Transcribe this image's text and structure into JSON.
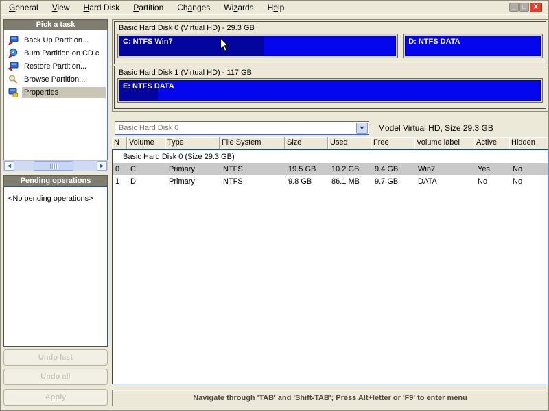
{
  "menu": {
    "items": [
      {
        "pre": "",
        "key": "G",
        "post": "eneral"
      },
      {
        "pre": "",
        "key": "V",
        "post": "iew"
      },
      {
        "pre": "",
        "key": "H",
        "post": "ard Disk"
      },
      {
        "pre": "",
        "key": "P",
        "post": "artition"
      },
      {
        "pre": "Ch",
        "key": "a",
        "post": "nges"
      },
      {
        "pre": "Wi",
        "key": "z",
        "post": "ards"
      },
      {
        "pre": "H",
        "key": "e",
        "post": "lp"
      }
    ]
  },
  "window_controls": {
    "minimize": "_",
    "maximize": "□",
    "close": "✕"
  },
  "sidebar": {
    "pick_task_title": "Pick a task",
    "tasks": [
      {
        "icon": "backup-disk-icon",
        "label": "Back Up Partition..."
      },
      {
        "icon": "burn-cd-icon",
        "label": "Burn Partition on CD c"
      },
      {
        "icon": "restore-disk-icon",
        "label": "Restore Partition..."
      },
      {
        "icon": "browse-icon",
        "label": "Browse Partition..."
      },
      {
        "icon": "properties-icon",
        "label": "Properties",
        "selected": true
      }
    ],
    "pending_title": "Pending operations",
    "pending_empty": "<No pending operations>",
    "buttons": {
      "undo_last": "Undo last",
      "undo_all": "Undo all",
      "apply": "Apply"
    }
  },
  "disks": [
    {
      "title": "Basic Hard Disk 0 (Virtual HD) - 29.3 GB",
      "partitions": [
        {
          "label": "C: NTFS Win7",
          "used_pct": 52
        },
        {
          "label": "D: NTFS DATA",
          "used_pct": 0
        }
      ]
    },
    {
      "title": "Basic Hard Disk 1 (Virtual HD) - 117 GB",
      "partitions": [
        {
          "label": "E: NTFS DATA",
          "used_pct": 9
        }
      ]
    }
  ],
  "selector": {
    "value": "Basic Hard Disk 0",
    "info": "Model Virtual HD, Size 29.3 GB"
  },
  "table": {
    "columns": [
      "N",
      "Volume",
      "Type",
      "File System",
      "Size",
      "Used",
      "Free",
      "Volume label",
      "Active",
      "Hidden"
    ],
    "group_row": "Basic Hard Disk 0 (Size 29.3 GB)",
    "rows": [
      {
        "selected": true,
        "cells": [
          "0",
          "C:",
          "Primary",
          "NTFS",
          "19.5 GB",
          "10.2 GB",
          "9.4 GB",
          "Win7",
          "Yes",
          "No"
        ]
      },
      {
        "selected": false,
        "cells": [
          "1",
          "D:",
          "Primary",
          "NTFS",
          "9.8 GB",
          "86.1 MB",
          "9.7 GB",
          "DATA",
          "No",
          "No"
        ]
      }
    ]
  },
  "status_bar": {
    "text": "Navigate through 'TAB' and 'Shift-TAB'; Press Alt+letter or 'F9' to enter menu"
  },
  "colors": {
    "partition_free": "#0406ee",
    "partition_used": "#04049e",
    "panel_header_bg": "#7f7d70",
    "selection_gray": "#c9c9c9",
    "task_selection": "#c9c6b7",
    "close_button_red": "#e2422c",
    "window_bg": "#ece9d8"
  }
}
